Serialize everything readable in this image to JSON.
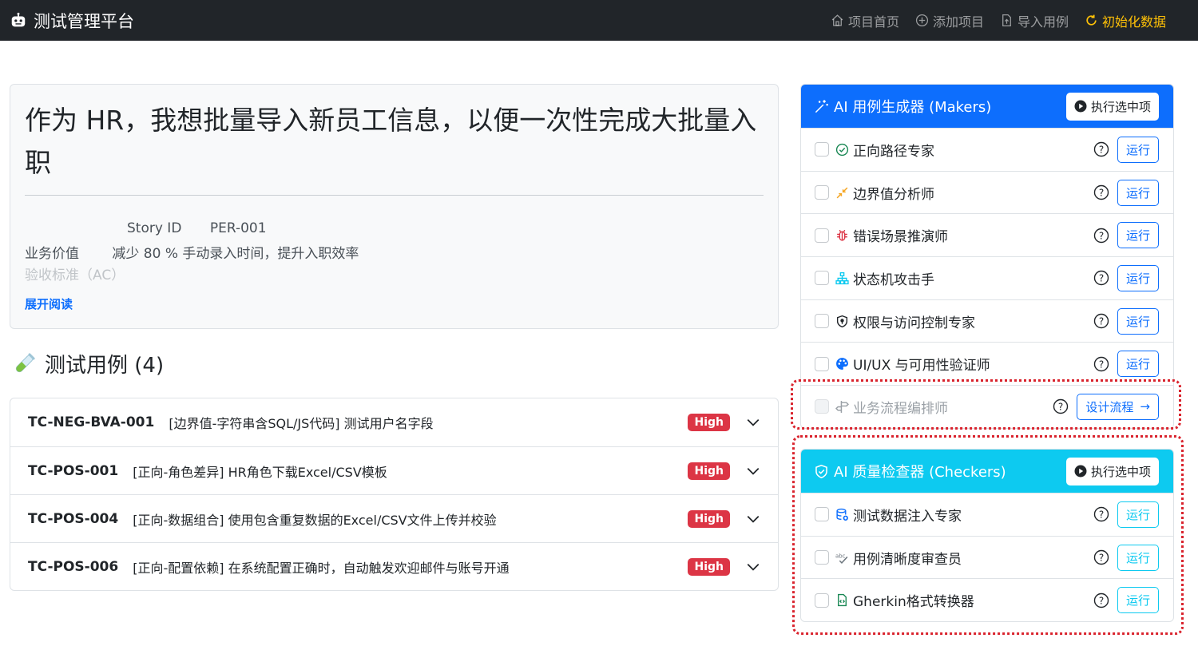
{
  "app": {
    "brand": "测试管理平台",
    "nav": [
      {
        "label": "项目首页",
        "icon": "home-icon"
      },
      {
        "label": "添加项目",
        "icon": "plus-circle-icon"
      },
      {
        "label": "导入用例",
        "icon": "file-upload-icon"
      },
      {
        "label": "初始化数据",
        "icon": "refresh-icon",
        "active": true
      }
    ]
  },
  "story": {
    "title": "作为 HR，我想批量导入新员工信息，以便一次性完成大批量入职",
    "story_id_label": "Story ID",
    "story_id": "PER-001",
    "value_label": "业务价值",
    "value": "减少 80 % 手动录入时间，提升入职效率",
    "ac_label": "验收标准（AC）",
    "expand": "展开阅读"
  },
  "testcases": {
    "heading": "测试用例 (4)",
    "items": [
      {
        "id": "TC-NEG-BVA-001",
        "title": "[边界值-字符串含SQL/JS代码] 测试用户名字段",
        "priority": "High"
      },
      {
        "id": "TC-POS-001",
        "title": "[正向-角色差异] HR角色下载Excel/CSV模板",
        "priority": "High"
      },
      {
        "id": "TC-POS-004",
        "title": "[正向-数据组合] 使用包含重复数据的Excel/CSV文件上传并校验",
        "priority": "High"
      },
      {
        "id": "TC-POS-006",
        "title": "[正向-配置依赖] 在系统配置正确时，自动触发欢迎邮件与账号开通",
        "priority": "High"
      }
    ]
  },
  "makers": {
    "title": "AI 用例生成器 (Makers)",
    "run_selected": "执行选中项",
    "run": "运行",
    "items": [
      {
        "label": "正向路径专家",
        "icon": "check-circle-icon"
      },
      {
        "label": "边界值分析师",
        "icon": "arrows-collapse-icon"
      },
      {
        "label": "错误场景推演师",
        "icon": "bug-icon"
      },
      {
        "label": "状态机攻击手",
        "icon": "diagram-icon"
      },
      {
        "label": "权限与访问控制专家",
        "icon": "shield-lock-icon"
      },
      {
        "label": "UI/UX 与可用性验证师",
        "icon": "palette-icon"
      }
    ],
    "workflow": {
      "label": "业务流程编排师",
      "button": "设计流程"
    }
  },
  "checkers": {
    "title": "AI 质量检查器 (Checkers)",
    "run_selected": "执行选中项",
    "run": "运行",
    "items": [
      {
        "label": "测试数据注入专家",
        "icon": "database-icon"
      },
      {
        "label": "用例清晰度审查员",
        "icon": "spellcheck-icon"
      },
      {
        "label": "Gherkin格式转换器",
        "icon": "file-code-icon"
      }
    ]
  },
  "colors": {
    "primary": "#0d6efd",
    "info": "#0dcaf0",
    "danger": "#dc3545",
    "warning": "#ffc107",
    "dark": "#212529"
  }
}
